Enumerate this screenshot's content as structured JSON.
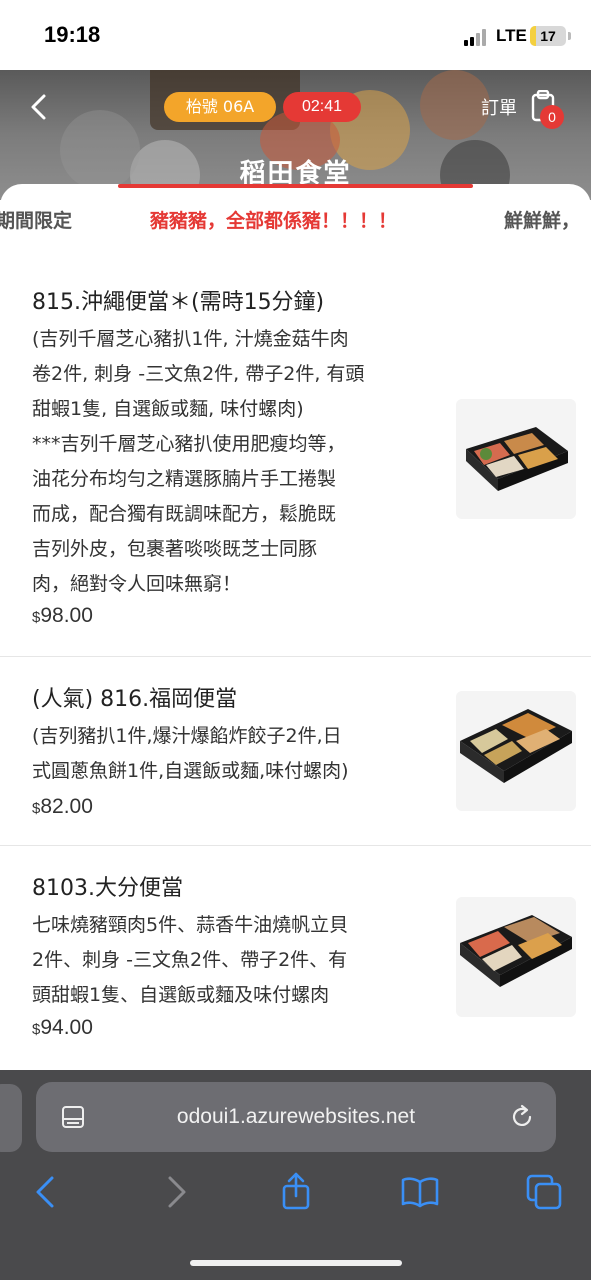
{
  "status_bar": {
    "time": "19:18",
    "network": "LTE",
    "battery": "17",
    "battery_level": 0.17
  },
  "header": {
    "table_label": "枱號  06A",
    "timer": "02:41",
    "order_label": "訂單",
    "order_count": "0",
    "shop_name": "稻田食堂"
  },
  "categories": [
    {
      "label": "期間限定",
      "active": false
    },
    {
      "label": "豬豬豬，全部都係豬！！！！",
      "active": true
    },
    {
      "label": "鮮鮮鮮，",
      "active": false
    }
  ],
  "menu": {
    "items": [
      {
        "name": "815.沖繩便當＊(需時15分鐘)",
        "desc": "(吉列千層芝心豬扒1件, 汁燒金菇牛肉卷2件, 刺身 -三文魚2件, 帶子2件, 有頭甜蝦1隻, 自選飯或麵, 味付螺肉)\n***吉列千層芝心豬扒使用肥瘦均等，油花分布均勻之精選豚腩片手工捲製而成，配合獨有既調味配方，鬆脆既吉列外皮，包裹著啖啖既芝士同豚肉，絕對令人回味無窮！",
        "currency": "$",
        "price": "98.00"
      },
      {
        "name": "(人氣) 816.福岡便當",
        "desc": "(吉列豬扒1件,爆汁爆餡炸餃子2件,日式圓蔥魚餅1件,自選飯或麵,味付螺肉)",
        "currency": "$",
        "price": "82.00"
      },
      {
        "name": "8103.大分便當",
        "desc": "七味燒豬頸肉5件、蒜香牛油燒帆立貝2件、刺身 -三文魚2件、帶子2件、有頭甜蝦1隻、自選飯或麵及味付螺肉",
        "currency": "$",
        "price": "94.00"
      }
    ]
  },
  "browser": {
    "url": "odoui1.azurewebsites.net"
  },
  "colors": {
    "accent": "#e53935",
    "table_badge": "#f3a52a",
    "toolbar": "#4a4a4c",
    "ios_blue": "#3a8ff5"
  }
}
